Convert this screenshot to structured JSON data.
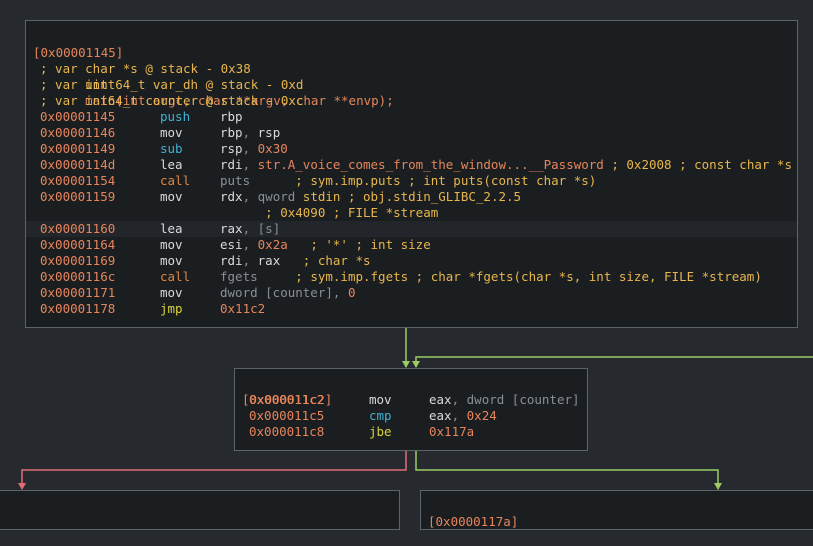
{
  "node1": {
    "header": "[0x00001145]",
    "signature": {
      "ret_type": "int",
      "name": "main",
      "params": "(int argc, char **argv, char **envp);"
    },
    "vars": [
      "; var char *s @ stack - 0x38",
      "; var uint64_t var_dh @ stack - 0xd",
      "; var int64_t counter @ stack - 0xc"
    ],
    "rows": [
      {
        "addr": "0x00001145",
        "mn": "push",
        "mn_color": "blue",
        "parts": [
          {
            "t": "rbp",
            "c": "reg"
          }
        ]
      },
      {
        "addr": "0x00001146",
        "mn": "mov",
        "mn_color": "white",
        "parts": [
          {
            "t": "rbp",
            "c": "reg"
          },
          {
            "t": ", ",
            "c": "dim"
          },
          {
            "t": "rsp",
            "c": "reg"
          }
        ]
      },
      {
        "addr": "0x00001149",
        "mn": "sub",
        "mn_color": "blue",
        "parts": [
          {
            "t": "rsp",
            "c": "reg"
          },
          {
            "t": ", ",
            "c": "dim"
          },
          {
            "t": "0x30",
            "c": "num"
          }
        ]
      },
      {
        "addr": "0x0000114d",
        "mn": "lea",
        "mn_color": "white",
        "parts": [
          {
            "t": "rdi",
            "c": "reg"
          },
          {
            "t": ", ",
            "c": "dim"
          },
          {
            "t": "str.A_voice_comes_from_the_window...__Password",
            "c": "str"
          },
          {
            "t": " ; 0x2008 ; const char *s",
            "c": "cmt"
          }
        ]
      },
      {
        "addr": "0x00001154",
        "mn": "call",
        "mn_color": "orange",
        "parts": [
          {
            "t": "puts",
            "c": "gray"
          },
          {
            "t": "      ; sym.imp.puts ; int puts(const char *s)",
            "c": "cmt"
          }
        ]
      },
      {
        "addr": "0x00001159",
        "mn": "mov",
        "mn_color": "white",
        "parts": [
          {
            "t": "rdx",
            "c": "reg"
          },
          {
            "t": ", ",
            "c": "dim"
          },
          {
            "t": "qword ",
            "c": "gray"
          },
          {
            "t": "stdin",
            "c": "obj"
          },
          {
            "t": " ; obj.stdin_GLIBC_2.2.5",
            "c": "cmt"
          }
        ]
      },
      {
        "addr": "",
        "mn": "",
        "mn_color": "white",
        "parts": [
          {
            "t": "      ; 0x4090 ; FILE *stream",
            "c": "cmt"
          }
        ]
      },
      {
        "addr": "0x00001160",
        "mn": "lea",
        "mn_color": "white",
        "parts": [
          {
            "t": "rax",
            "c": "reg"
          },
          {
            "t": ", ",
            "c": "dim"
          },
          {
            "t": "[s]",
            "c": "gray"
          }
        ],
        "highlight": true
      },
      {
        "addr": "0x00001164",
        "mn": "mov",
        "mn_color": "white",
        "parts": [
          {
            "t": "esi",
            "c": "reg"
          },
          {
            "t": ", ",
            "c": "dim"
          },
          {
            "t": "0x2a",
            "c": "num"
          },
          {
            "t": "   ; '*' ; int size",
            "c": "cmt"
          }
        ]
      },
      {
        "addr": "0x00001169",
        "mn": "mov",
        "mn_color": "white",
        "parts": [
          {
            "t": "rdi",
            "c": "reg"
          },
          {
            "t": ", ",
            "c": "dim"
          },
          {
            "t": "rax",
            "c": "reg"
          },
          {
            "t": "   ; char *s",
            "c": "cmt"
          }
        ]
      },
      {
        "addr": "0x0000116c",
        "mn": "call",
        "mn_color": "orange",
        "parts": [
          {
            "t": "fgets",
            "c": "gray"
          },
          {
            "t": "     ; sym.imp.fgets ; char *fgets(char *s, int size, FILE *stream)",
            "c": "cmt"
          }
        ]
      },
      {
        "addr": "0x00001171",
        "mn": "mov",
        "mn_color": "white",
        "parts": [
          {
            "t": "dword ",
            "c": "gray"
          },
          {
            "t": "[counter]",
            "c": "gray"
          },
          {
            "t": ", ",
            "c": "dim"
          },
          {
            "t": "0",
            "c": "num"
          }
        ]
      },
      {
        "addr": "0x00001178",
        "mn": "jmp",
        "mn_color": "yellow",
        "parts": [
          {
            "t": "0x11c2",
            "c": "num"
          }
        ]
      }
    ]
  },
  "node2": {
    "header": "[0x000011c2]",
    "rows": [
      {
        "addr": "0x000011c2",
        "mn": "mov",
        "mn_color": "white",
        "parts": [
          {
            "t": "eax",
            "c": "reg"
          },
          {
            "t": ", ",
            "c": "dim"
          },
          {
            "t": "dword ",
            "c": "gray"
          },
          {
            "t": "[counter]",
            "c": "gray"
          }
        ]
      },
      {
        "addr": "0x000011c5",
        "mn": "cmp",
        "mn_color": "blue",
        "parts": [
          {
            "t": "eax",
            "c": "reg"
          },
          {
            "t": ", ",
            "c": "dim"
          },
          {
            "t": "0x24",
            "c": "num"
          }
        ]
      },
      {
        "addr": "0x000011c8",
        "mn": "jbe",
        "mn_color": "yellow",
        "parts": [
          {
            "t": "0x117a",
            "c": "num"
          }
        ]
      }
    ]
  },
  "node3": {
    "header": "[0x0000117a]"
  },
  "colors": {
    "background": "#262a2e",
    "node_bg": "#1b1e21",
    "node_border": "#5c636a",
    "edge_true": "#9ccc65",
    "edge_false": "#e06c75"
  }
}
